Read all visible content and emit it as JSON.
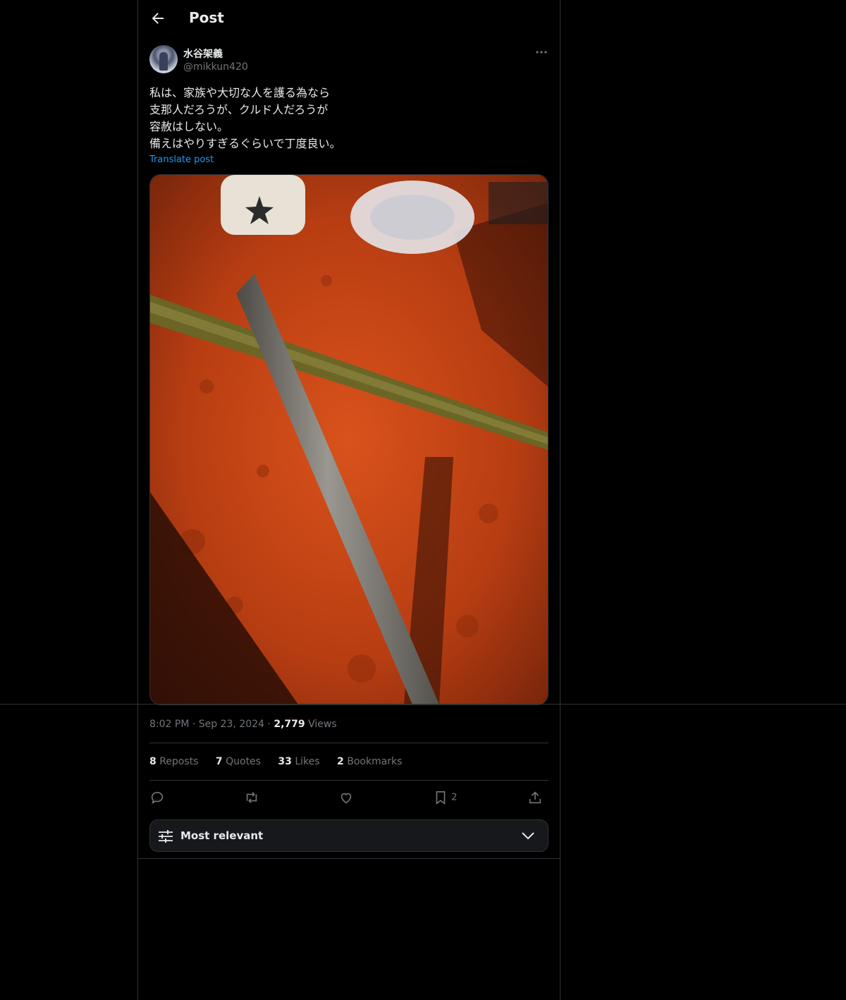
{
  "header": {
    "title": "Post"
  },
  "author": {
    "name": "水谷架義",
    "handle": "@mikkun420"
  },
  "post": {
    "lines": [
      "私は、家族や大切な人を護る為なら",
      "支那人だろうが、クルド人だろうが",
      "容赦はしない。",
      "備えはやりすぎるぐらいで丁度良い。"
    ],
    "translate_label": "Translate post"
  },
  "meta": {
    "time": "8:02 PM",
    "date": "Sep 23, 2024",
    "views_count": "2,779",
    "views_label": "Views"
  },
  "stats": [
    {
      "count": "8",
      "label": "Reposts"
    },
    {
      "count": "7",
      "label": "Quotes"
    },
    {
      "count": "33",
      "label": "Likes"
    },
    {
      "count": "2",
      "label": "Bookmarks"
    }
  ],
  "actions": {
    "bookmark_count": "2"
  },
  "sort": {
    "label": "Most relevant"
  }
}
